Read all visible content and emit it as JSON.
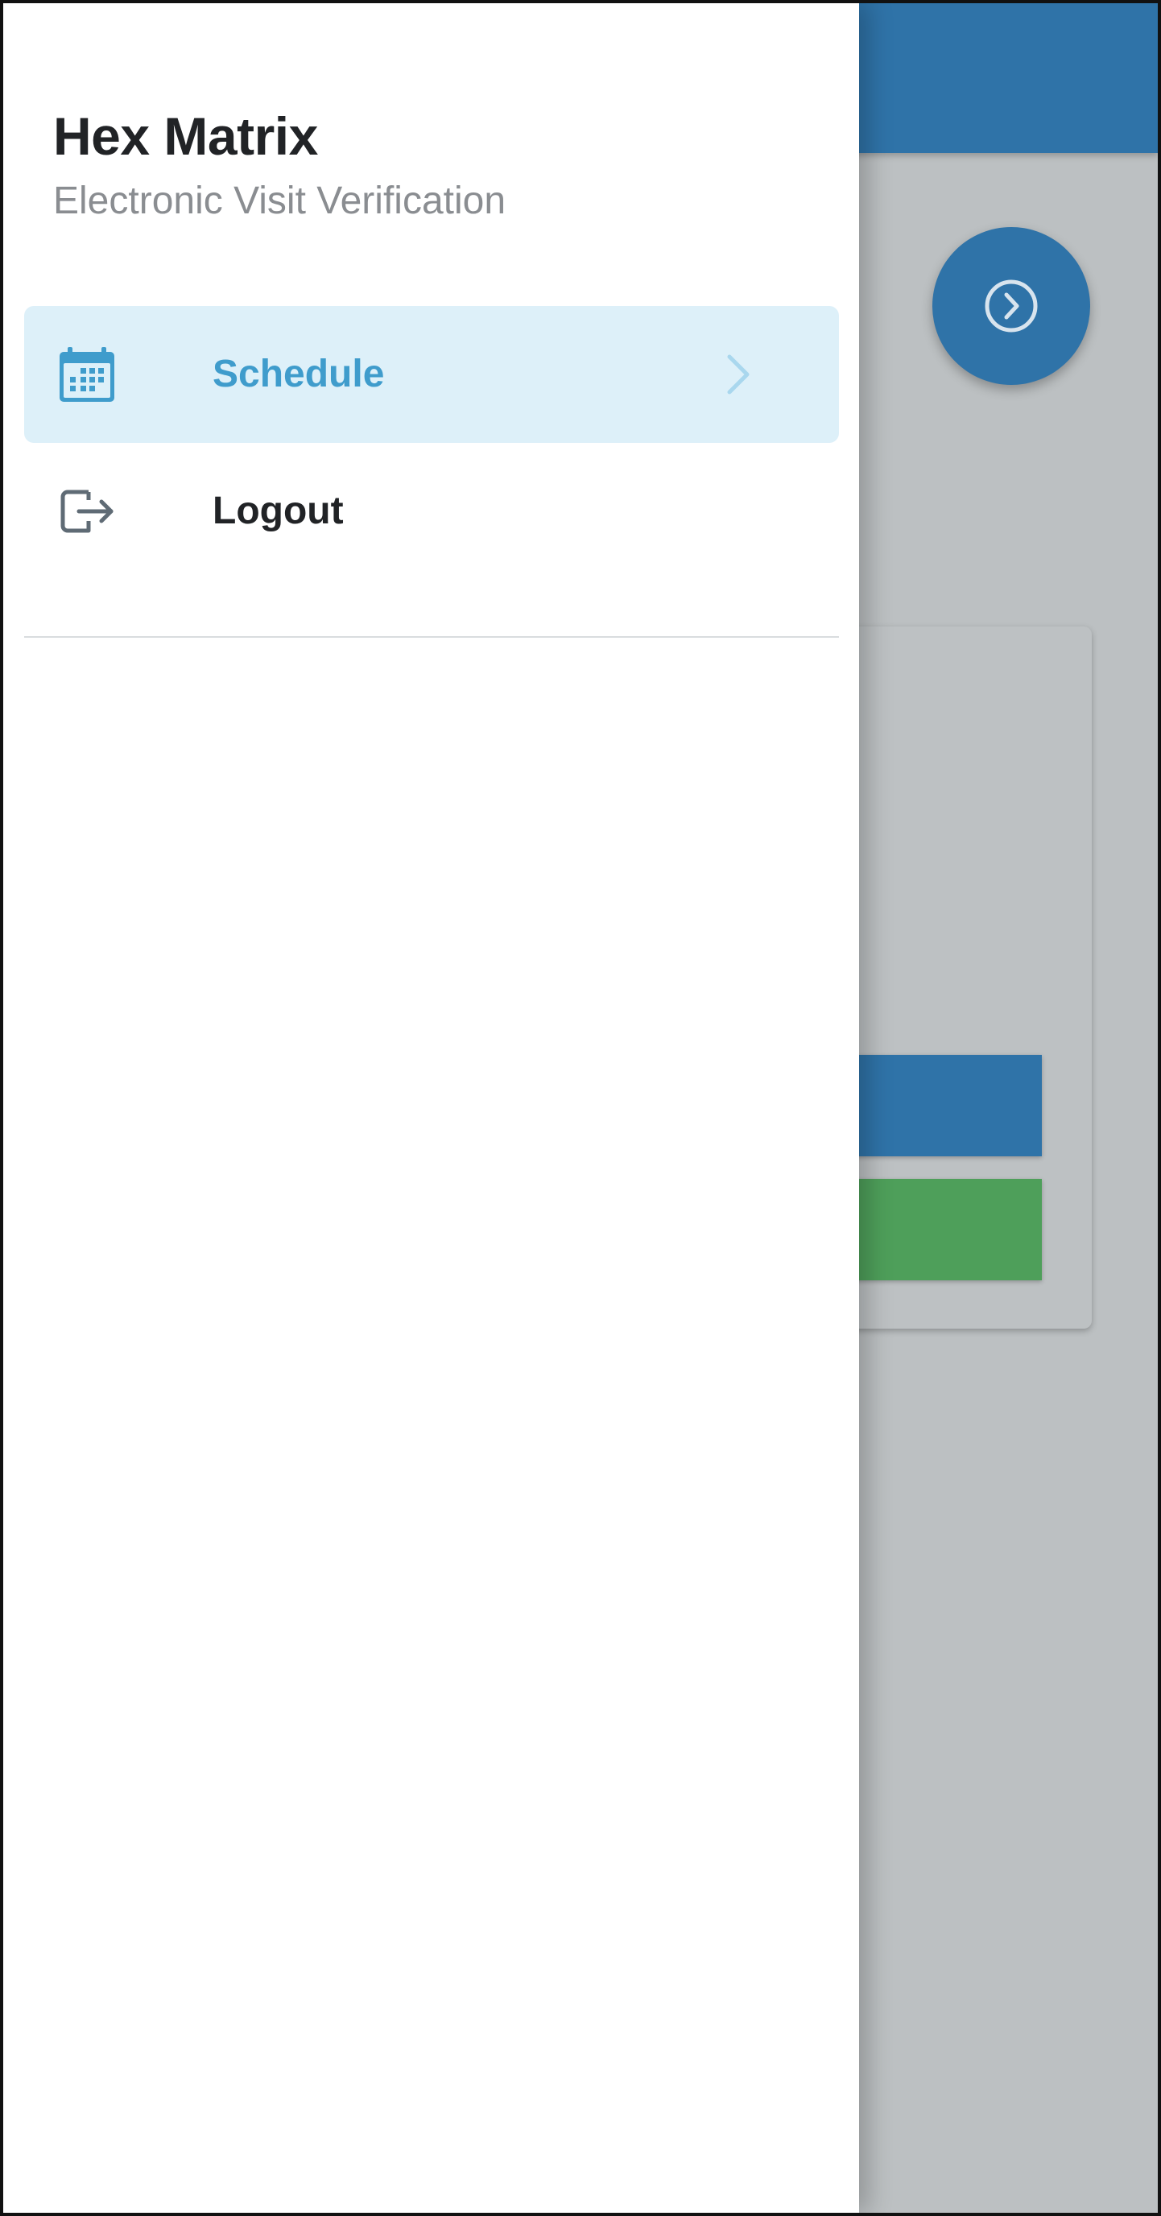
{
  "drawer": {
    "title": "Hex Matrix",
    "subtitle": "Electronic Visit Verification",
    "items": [
      {
        "label": "Schedule",
        "icon": "calendar-icon",
        "active": true
      },
      {
        "label": "Logout",
        "icon": "logout-icon",
        "active": false
      }
    ]
  },
  "colors": {
    "primary": "#2f73a8",
    "accent": "#3f9ccc",
    "active_bg": "#ddf0f9",
    "success": "#4e9f5a",
    "scrim": "#bcc0c2"
  },
  "background": {
    "fab_icon": "chevron-right-circle-icon"
  }
}
